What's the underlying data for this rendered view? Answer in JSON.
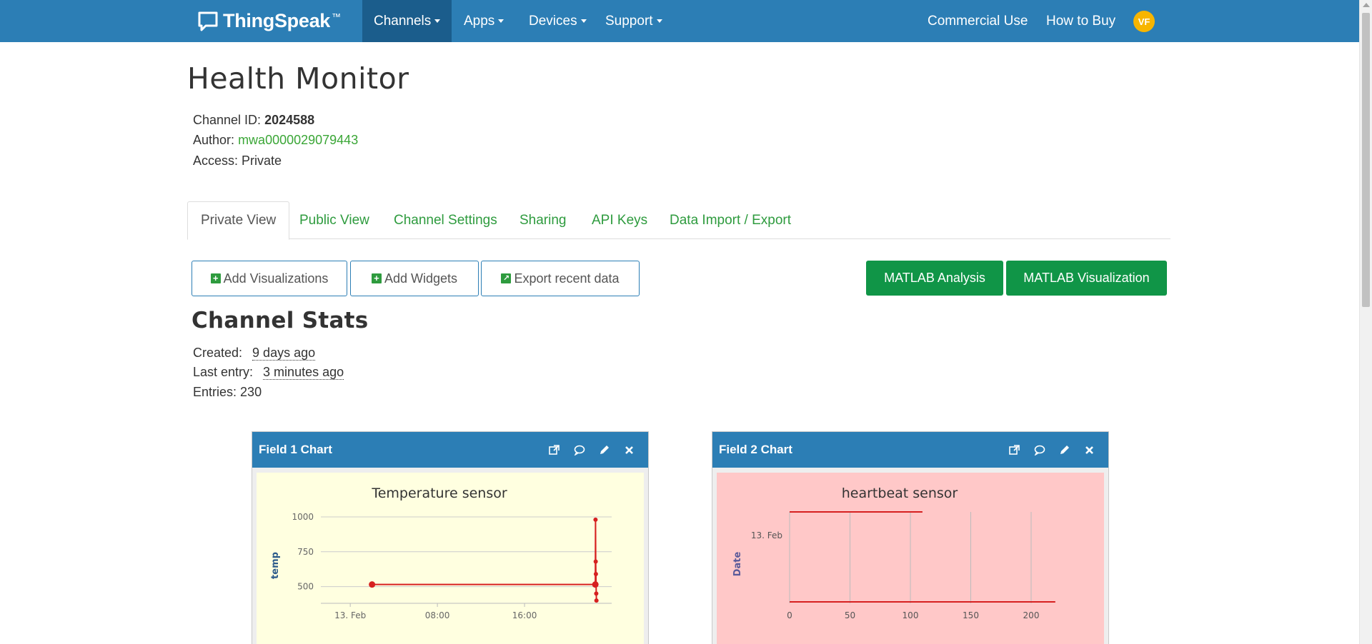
{
  "nav": {
    "brand": "ThingSpeak",
    "brand_tm": "™",
    "channels": "Channels",
    "apps": "Apps",
    "devices": "Devices",
    "support": "Support",
    "commercial": "Commercial Use",
    "how_to_buy": "How to Buy",
    "avatar_initials": "VF"
  },
  "channel": {
    "title": "Health Monitor",
    "id_label": "Channel ID:",
    "id_value": "2024588",
    "author_label": "Author:",
    "author_value": "mwa0000029079443",
    "access_label": "Access:",
    "access_value": "Private"
  },
  "tabs": [
    {
      "label": "Private View",
      "active": true
    },
    {
      "label": "Public View"
    },
    {
      "label": "Channel Settings"
    },
    {
      "label": "Sharing"
    },
    {
      "label": "API Keys"
    },
    {
      "label": "Data Import / Export"
    }
  ],
  "buttons": {
    "add_visualizations": "Add Visualizations",
    "add_widgets": "Add Widgets",
    "export_recent": "Export recent data",
    "matlab_analysis": "MATLAB Analysis",
    "matlab_visualization": "MATLAB Visualization"
  },
  "stats": {
    "title": "Channel Stats",
    "created_label": "Created:",
    "created_value": "9 days ago",
    "last_entry_label": "Last entry:",
    "last_entry_value": "3 minutes ago",
    "entries_label": "Entries:",
    "entries_value": "230"
  },
  "panels": [
    {
      "title": "Field 1 Chart"
    },
    {
      "title": "Field 2 Chart"
    }
  ],
  "colors": {
    "navbar": "#2c7eb5",
    "nav_active": "#1b5d8c",
    "link_green": "#3aa636",
    "button_green": "#109547",
    "avatar": "#f7b500",
    "chart1_bg": "#ffffe0",
    "chart2_bg": "#ffc8c8",
    "series": "#d62020"
  },
  "chart_data": [
    {
      "type": "line",
      "title": "Temperature sensor",
      "ylabel": "temp",
      "xlabel": "",
      "x_ticks": [
        "13. Feb",
        "08:00",
        "16:00"
      ],
      "y_ticks": [
        500,
        750,
        1000
      ],
      "ylim": [
        380,
        1000
      ],
      "grid": true,
      "series": [
        {
          "points": [
            {
              "x": "13. Feb 02:00",
              "y": 515
            },
            {
              "x": "13. Feb 22:30",
              "y": 515
            },
            {
              "x": "13. Feb 22:31",
              "y": 980
            },
            {
              "x": "13. Feb 22:32",
              "y": 680
            },
            {
              "x": "13. Feb 22:33",
              "y": 590
            },
            {
              "x": "13. Feb 22:34",
              "y": 520
            },
            {
              "x": "13. Feb 22:35",
              "y": 450
            },
            {
              "x": "13. Feb 22:36",
              "y": 400
            }
          ]
        }
      ]
    },
    {
      "type": "line",
      "title": "heartbeat sensor",
      "ylabel": "Date",
      "xlabel": "",
      "x_ticks": [
        0,
        50,
        100,
        150,
        200
      ],
      "y_ticks": [
        "13. Feb"
      ],
      "xlim": [
        0,
        220
      ],
      "grid": true,
      "series": [
        {
          "segments": [
            {
              "y": "top",
              "x": [
                0,
                110
              ]
            },
            {
              "y": "bottom",
              "x": [
                0,
                220
              ]
            }
          ]
        }
      ]
    }
  ]
}
